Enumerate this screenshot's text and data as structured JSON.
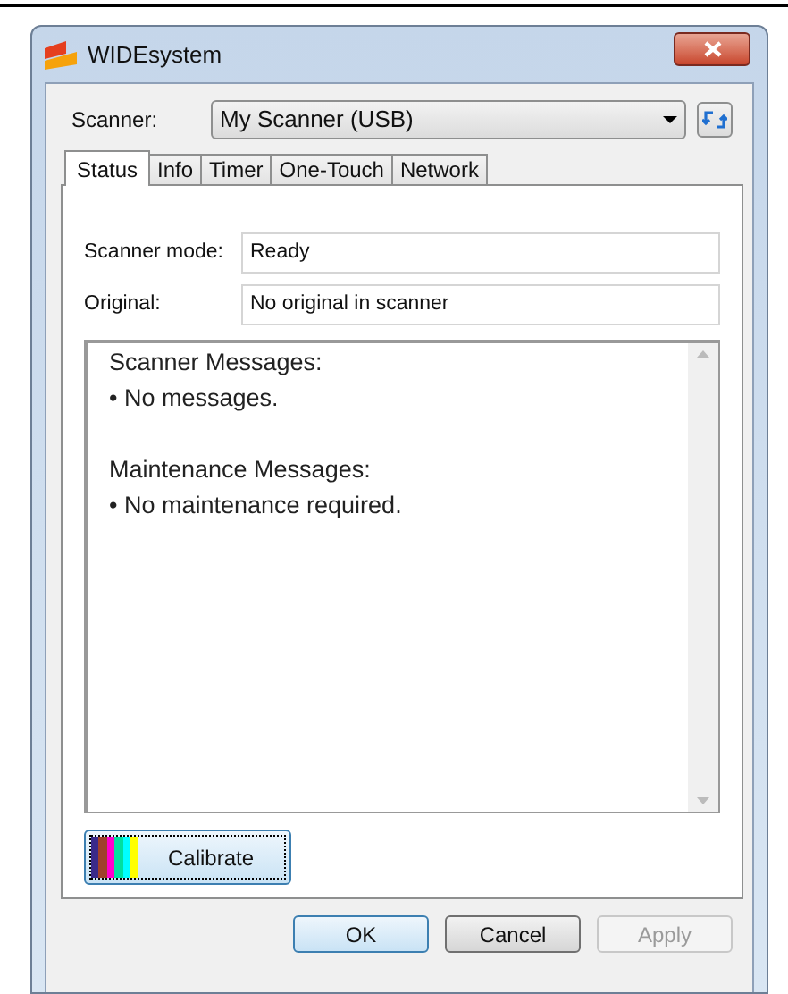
{
  "window": {
    "title": "WIDEsystem"
  },
  "scanner": {
    "label": "Scanner:",
    "value": "My Scanner (USB)"
  },
  "tabs": [
    {
      "label": "Status",
      "selected": true
    },
    {
      "label": "Info",
      "selected": false
    },
    {
      "label": "Timer",
      "selected": false
    },
    {
      "label": "One-Touch",
      "selected": false
    },
    {
      "label": "Network",
      "selected": false
    }
  ],
  "fields": [
    {
      "label": "Scanner mode:",
      "value": "Ready"
    },
    {
      "label": "Original:",
      "value": "No original in scanner"
    }
  ],
  "messages": [
    {
      "heading": "Scanner Messages:",
      "items": [
        "• No messages."
      ]
    },
    {
      "heading": "Maintenance Messages:",
      "items": [
        "• No maintenance required."
      ]
    }
  ],
  "calibrate": {
    "label": "Calibrate"
  },
  "buttons": [
    {
      "label": "OK",
      "default": true,
      "disabled": false
    },
    {
      "label": "Cancel",
      "default": false,
      "disabled": false
    },
    {
      "label": "Apply",
      "default": false,
      "disabled": true
    }
  ]
}
